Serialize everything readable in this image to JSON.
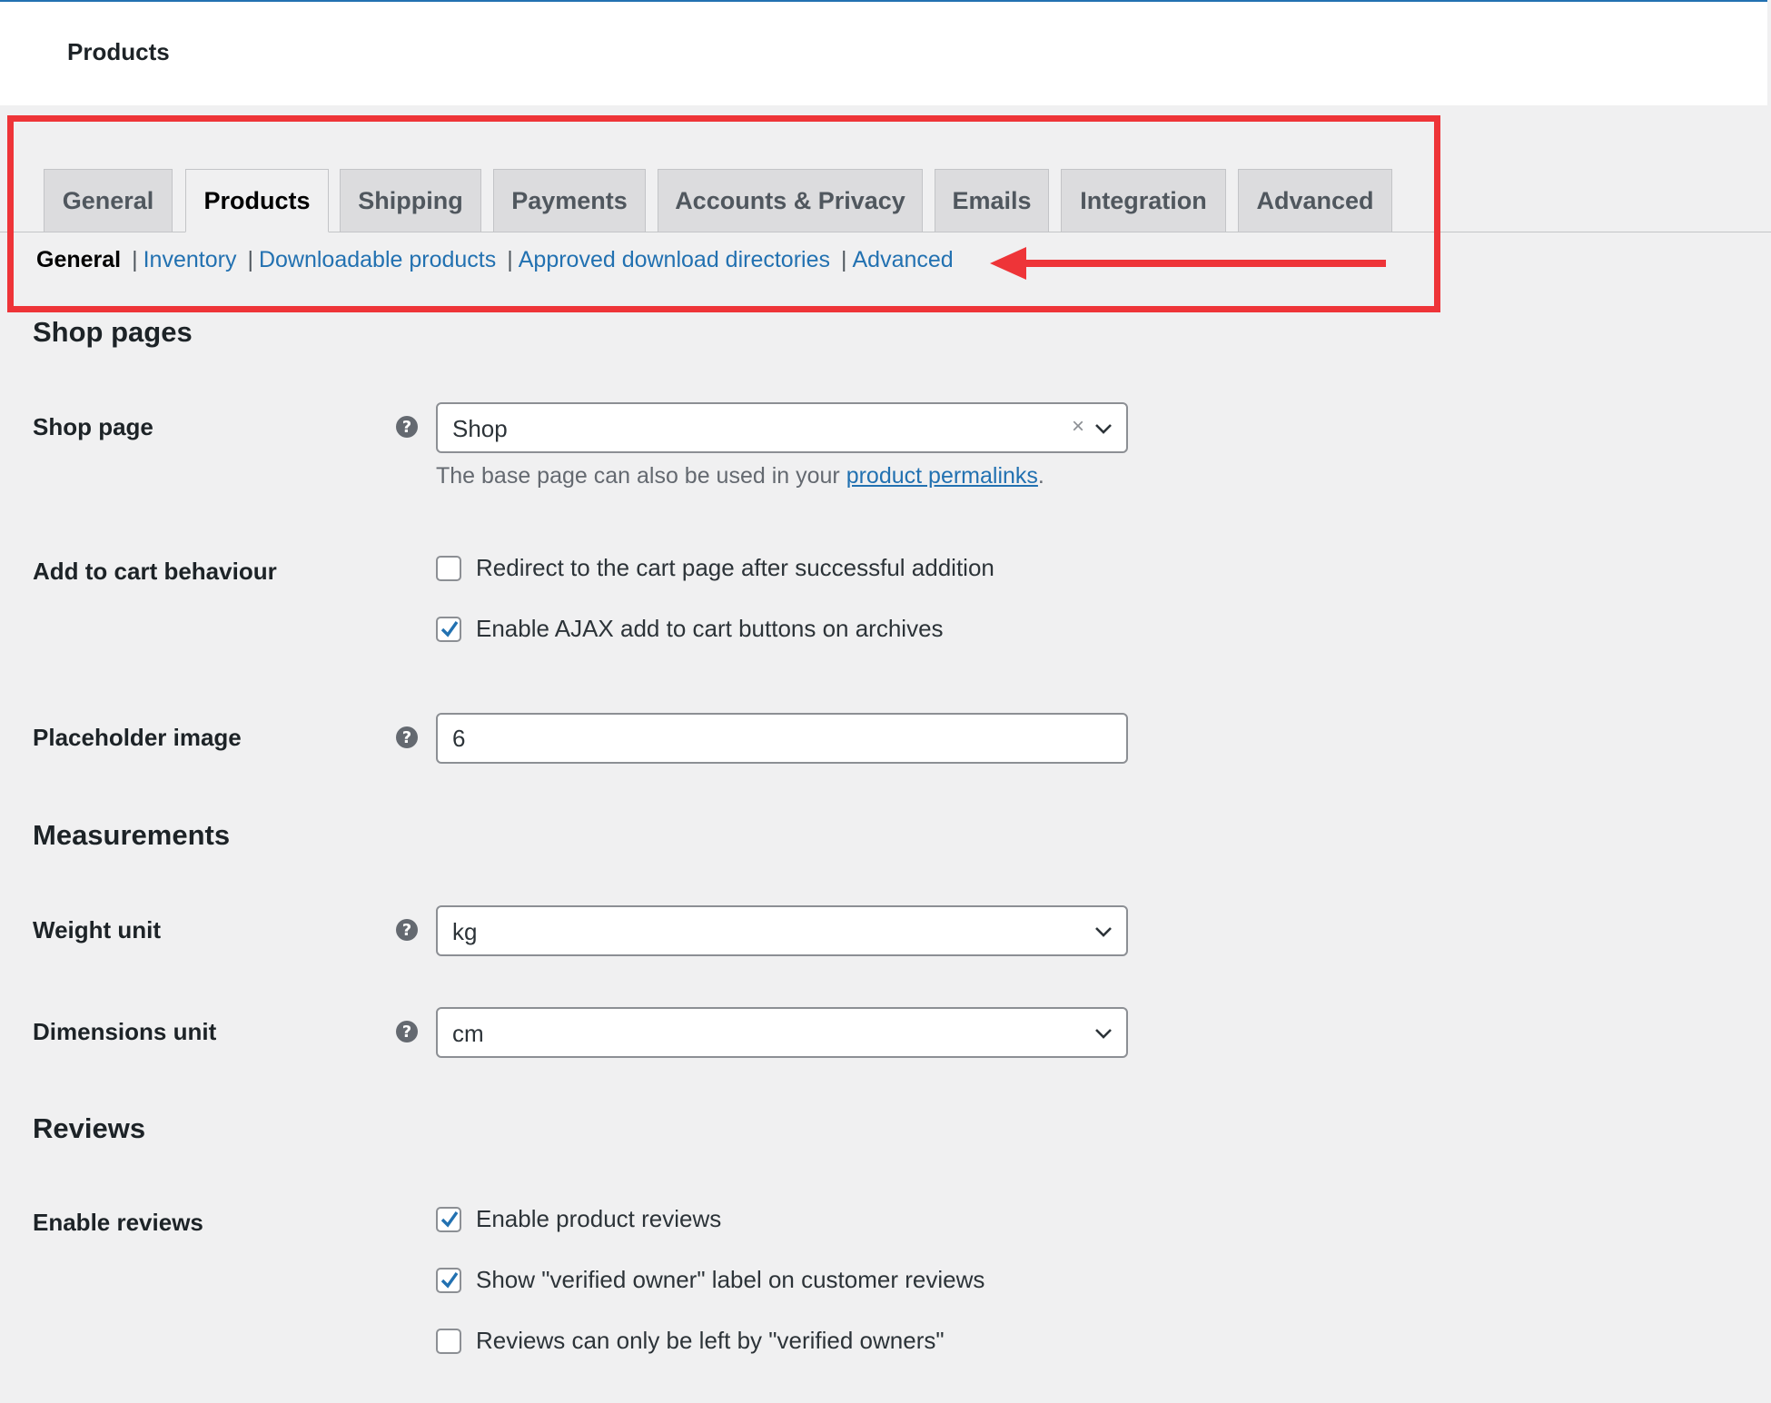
{
  "header": {
    "title": "Products"
  },
  "tabs": [
    {
      "label": "General",
      "active": false
    },
    {
      "label": "Products",
      "active": true
    },
    {
      "label": "Shipping",
      "active": false
    },
    {
      "label": "Payments",
      "active": false
    },
    {
      "label": "Accounts & Privacy",
      "active": false
    },
    {
      "label": "Emails",
      "active": false
    },
    {
      "label": "Integration",
      "active": false
    },
    {
      "label": "Advanced",
      "active": false
    }
  ],
  "subsections": {
    "current": "General",
    "links": [
      "Inventory",
      "Downloadable products",
      "Approved download directories",
      "Advanced"
    ],
    "separator": "|"
  },
  "annotation": {
    "box_color": "#ee3438",
    "arrow_color": "#ee3438"
  },
  "shop_pages": {
    "title": "Shop pages",
    "shop_page": {
      "label": "Shop page",
      "value": "Shop",
      "clear_icon": "×",
      "description_prefix": "The base page can also be used in your ",
      "description_link": "product permalinks",
      "description_suffix": "."
    },
    "add_to_cart": {
      "label": "Add to cart behaviour",
      "options": [
        {
          "label": "Redirect to the cart page after successful addition",
          "checked": false
        },
        {
          "label": "Enable AJAX add to cart buttons on archives",
          "checked": true
        }
      ]
    },
    "placeholder_image": {
      "label": "Placeholder image",
      "value": "6"
    }
  },
  "measurements": {
    "title": "Measurements",
    "weight_unit": {
      "label": "Weight unit",
      "value": "kg"
    },
    "dimensions_unit": {
      "label": "Dimensions unit",
      "value": "cm"
    }
  },
  "reviews": {
    "title": "Reviews",
    "enable_reviews": {
      "label": "Enable reviews",
      "options": [
        {
          "label": "Enable product reviews",
          "checked": true
        },
        {
          "label": "Show \"verified owner\" label on customer reviews",
          "checked": true
        },
        {
          "label": "Reviews can only be left by \"verified owners\"",
          "checked": false
        }
      ]
    }
  },
  "colors": {
    "link": "#2271b1",
    "background": "#f0f0f1",
    "check": "#2271b1"
  },
  "icons": {
    "help": "question-circle-icon",
    "dropdown": "chevron-down-icon",
    "clear": "clear-x-icon",
    "checkmark": "checkmark-icon"
  }
}
